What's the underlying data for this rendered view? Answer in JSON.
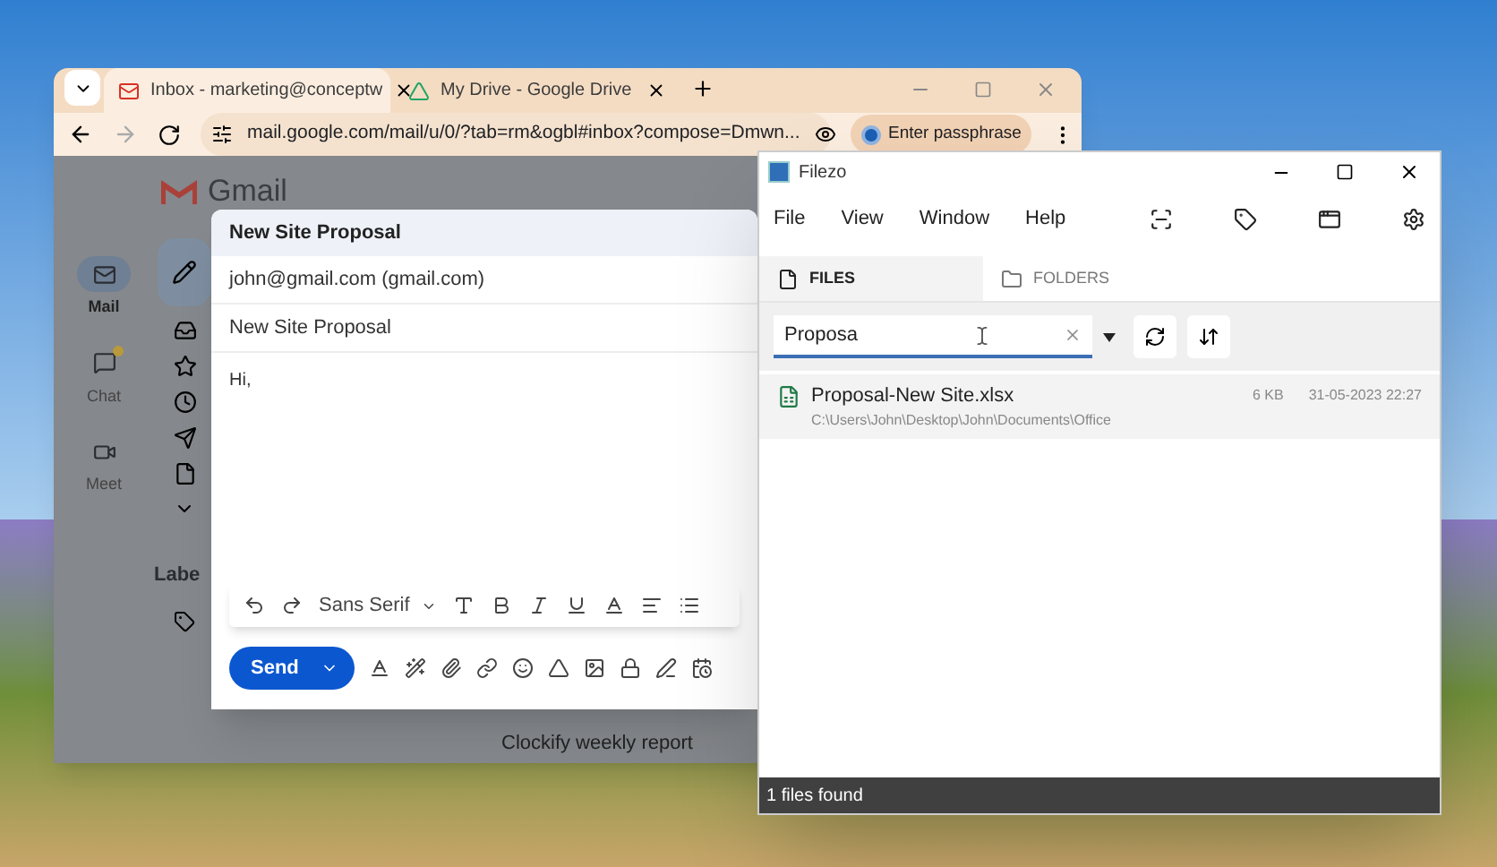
{
  "browser": {
    "tabs": [
      {
        "title": "Inbox - marketing@conceptw",
        "selected": true,
        "kind": "mail"
      },
      {
        "title": "My Drive - Google Drive",
        "selected": false,
        "kind": "drive"
      }
    ],
    "url": "mail.google.com/mail/u/0/?tab=rm&ogbl#inbox?compose=Dmwn...",
    "passphrase_button": "Enter passphrase"
  },
  "gmail": {
    "logo": "Gmail",
    "rail": [
      {
        "label": "Mail",
        "selected": true,
        "kind": "mail"
      },
      {
        "label": "Chat",
        "selected": false,
        "kind": "chat"
      },
      {
        "label": "Meet",
        "selected": false,
        "kind": "meet"
      }
    ],
    "labels_heading": "Labe",
    "list_row": "Clockify weekly report"
  },
  "compose": {
    "title": "New Site Proposal",
    "to": "john@gmail.com (gmail.com)",
    "subject": "New Site Proposal",
    "body": "Hi,",
    "font": "Sans Serif",
    "send": "Send"
  },
  "filezo": {
    "title": "Filezo",
    "menu": [
      "File",
      "View",
      "Window",
      "Help"
    ],
    "tabs": [
      {
        "label": "FILES",
        "selected": true,
        "kind": "file"
      },
      {
        "label": "FOLDERS",
        "selected": false,
        "kind": "folder"
      }
    ],
    "search": {
      "value": "Proposa"
    },
    "results": [
      {
        "name": "Proposal-New Site.xlsx",
        "path": "C:\\Users\\John\\Desktop\\John\\Documents\\Office",
        "size": "6 KB",
        "date": "31-05-2023 22:27"
      }
    ],
    "status": "1 files found"
  }
}
